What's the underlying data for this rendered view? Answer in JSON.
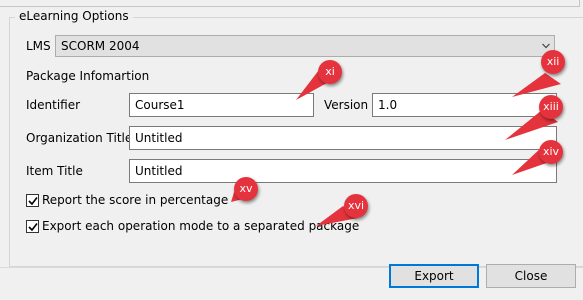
{
  "group": {
    "title": "eLearning Options"
  },
  "lms": {
    "label": "LMS",
    "value": "SCORM 2004"
  },
  "package": {
    "section_label": "Package Infomartion",
    "identifier_label": "Identifier",
    "identifier_value": "Course1",
    "version_label": "Version",
    "version_value": "1.0",
    "org_title_label": "Organization Title",
    "org_title_value": "Untitled",
    "item_title_label": "Item Title",
    "item_title_value": "Untitled"
  },
  "options": {
    "report_score_label": "Report the score in percentage",
    "report_score_checked": true,
    "export_modes_label": "Export each operation mode to a separated package",
    "export_modes_checked": true
  },
  "buttons": {
    "export": "Export",
    "close": "Close"
  },
  "callouts": [
    "xi",
    "xii",
    "xiii",
    "xiv",
    "xv",
    "xvi"
  ],
  "colors": {
    "callout": "#e5333d",
    "default_button_border": "#0078d7"
  }
}
